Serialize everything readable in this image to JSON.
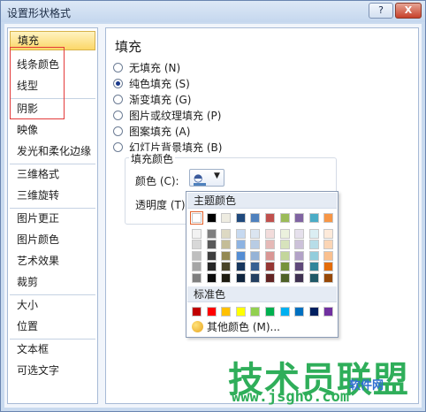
{
  "window": {
    "title": "设置形状格式",
    "help_label": "?",
    "close_label": "X"
  },
  "nav": {
    "items": [
      {
        "label": "填充",
        "selected": true
      },
      {
        "label": "线条颜色"
      },
      {
        "label": "线型"
      },
      {
        "label": "阴影"
      },
      {
        "label": "映像"
      },
      {
        "label": "发光和柔化边缘"
      },
      {
        "label": "三维格式"
      },
      {
        "label": "三维旋转"
      },
      {
        "label": "图片更正"
      },
      {
        "label": "图片颜色"
      },
      {
        "label": "艺术效果"
      },
      {
        "label": "裁剪"
      },
      {
        "label": "大小"
      },
      {
        "label": "位置"
      },
      {
        "label": "文本框"
      },
      {
        "label": "可选文字"
      }
    ]
  },
  "panel": {
    "title": "填充",
    "options": [
      {
        "label": "无填充 (N)",
        "checked": false
      },
      {
        "label": "纯色填充 (S)",
        "checked": true
      },
      {
        "label": "渐变填充 (G)",
        "checked": false
      },
      {
        "label": "图片或纹理填充 (P)",
        "checked": false
      },
      {
        "label": "图案填充 (A)",
        "checked": false
      },
      {
        "label": "幻灯片背景填充 (B)",
        "checked": false
      }
    ],
    "fill_color_group": "填充颜色",
    "color_label": "颜色 (C):",
    "transparency_label": "透明度 (T):"
  },
  "picker": {
    "theme_header": "主题颜色",
    "standard_header": "标准色",
    "more_colors": "其他颜色 (M)...",
    "theme_base": [
      "#ffffff",
      "#000000",
      "#eeece1",
      "#1f497d",
      "#4f81bd",
      "#c0504d",
      "#9bbb59",
      "#8064a2",
      "#4bacc6",
      "#f79646"
    ],
    "theme_shades": [
      [
        "#f2f2f2",
        "#7f7f7f",
        "#ddd9c3",
        "#c6d9f0",
        "#dbe5f1",
        "#f2dcdb",
        "#ebf1dd",
        "#e5e0ec",
        "#dbeef3",
        "#fdeada"
      ],
      [
        "#d8d8d8",
        "#595959",
        "#c4bd97",
        "#8db3e2",
        "#b8cce4",
        "#e5b9b7",
        "#d7e3bc",
        "#ccc1d9",
        "#b7dde8",
        "#fbd5b5"
      ],
      [
        "#bfbfbf",
        "#3f3f3f",
        "#938953",
        "#548dd4",
        "#95b3d7",
        "#d99694",
        "#c3d69b",
        "#b2a2c7",
        "#92cddc",
        "#fac08f"
      ],
      [
        "#a5a5a5",
        "#262626",
        "#494429",
        "#17365d",
        "#366092",
        "#953734",
        "#76923c",
        "#5f497a",
        "#31859b",
        "#e36c09"
      ],
      [
        "#7f7f7f",
        "#0c0c0c",
        "#1d1b10",
        "#0f243e",
        "#244061",
        "#632423",
        "#4f6128",
        "#3f3151",
        "#205867",
        "#974806"
      ]
    ],
    "standard": [
      "#c00000",
      "#ff0000",
      "#ffc000",
      "#ffff00",
      "#92d050",
      "#00b050",
      "#00b0f0",
      "#0070c0",
      "#002060",
      "#7030a0"
    ]
  },
  "watermark": {
    "cn": "技术员联盟",
    "url": "www.jsgho.com",
    "small": "软件网"
  }
}
